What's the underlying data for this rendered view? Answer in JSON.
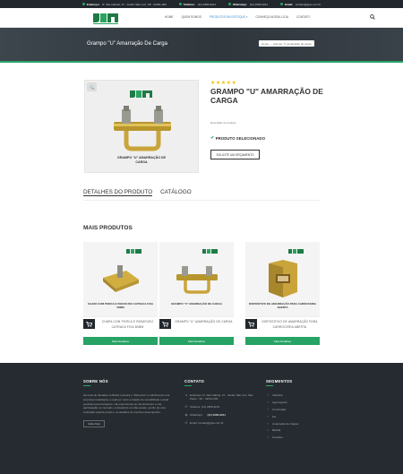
{
  "topbar": [
    {
      "label": "Endereço:",
      "value": "R. São Gabriel, 47 - Jardim São Luiz, SP - 02261-000"
    },
    {
      "label": "Telefone:",
      "value": "(11) 2906-6241"
    },
    {
      "label": "WhatsApp:",
      "value": "(11) 2906-6241"
    },
    {
      "label": "Email:",
      "value": "contato@jgse.com.br"
    }
  ],
  "nav": {
    "items": [
      "HOME",
      "QUEM SOMOS",
      "PRODUTOS EM ESTOQUE ▾",
      "CONHEÇA NOSSA LOJA",
      "CONTATO"
    ]
  },
  "hero": {
    "title": "Grampo \"U\" Amarração De Carga",
    "breadcrumb_home": "Home",
    "breadcrumb_sep": "›",
    "breadcrumb_current": "grampo \"u\" amarração de carga"
  },
  "product": {
    "image_caption": "GRAMPO \"U\" AMARRAÇÃO DE CARGA",
    "stars": "★★★★★",
    "title": "GRAMPO \"U\" AMARRAÇÃO DE CARGA",
    "description": "Descrição do produto",
    "selected": "PRODUTO SELECIONADO",
    "quote_button": "SOLICITE UM ORÇAMENTO"
  },
  "tabs": [
    "DETALHES DO PRODUTO",
    "CATÁLOGO"
  ],
  "more": {
    "heading": "MAIS PRODUTOS",
    "cards": [
      {
        "image_label": "CHAPA COM PORCA E PARAFUSO CATRACA FIXA 60MM",
        "name": "CHAPA COM PORCA E PARAFUSO CATRACA FIXA 60MM",
        "button": "Mais Detalhes"
      },
      {
        "image_label": "GRAMPO \"U\" AMARRAÇÃO DE CARGA",
        "name": "GRAMPO \"U\" AMARRAÇÃO DE CARGA",
        "button": "Mais Detalhes"
      },
      {
        "image_label": "DISPOSITIVO DE AMARRAÇÃO PARA CARROCERIA ABERTA",
        "name": "DISPOSITIVO DE AMARRAÇÃO PARA CARROCERIA ABERTA",
        "button": "Mais Detalhes"
      }
    ]
  },
  "footer": {
    "about": {
      "heading": "SOBRE NÓS",
      "text": "Há mais de décadas no Brasil, pioneira e \"Referente\" a indústria de uma empresa metalúrgica, a qual por meio a criação de versatilidade e atual produtos para transporte. Há proporcionar ao caminhoneiro e sua participação no mercado, contratando em dias atuais, escrito de uma instituição grande portes e os desafios do contínuo desempenho.",
      "button": "Saiba Mais"
    },
    "contact": {
      "heading": "CONTATO",
      "address": "Endereço: R. São Gabriel, 47 - Jardim São Luiz, São Paulo - SP - 02261-000",
      "phone": "Telefone: (11) 2906-6241",
      "whatsapp_label": "WhatsApp:",
      "whatsapp": "(11) 2906-6241",
      "email": "Email: contato@jgse.com.br"
    },
    "segments": {
      "heading": "SEGMENTOS",
      "items": [
        "Indústria",
        "Agronegócio",
        "Construção",
        "Fer",
        "Amarração de Cargas",
        "Bebida",
        "Grandes"
      ]
    }
  },
  "colors": {
    "accent": "#2ba36b",
    "dark": "#252b30",
    "star": "#f3c314"
  }
}
